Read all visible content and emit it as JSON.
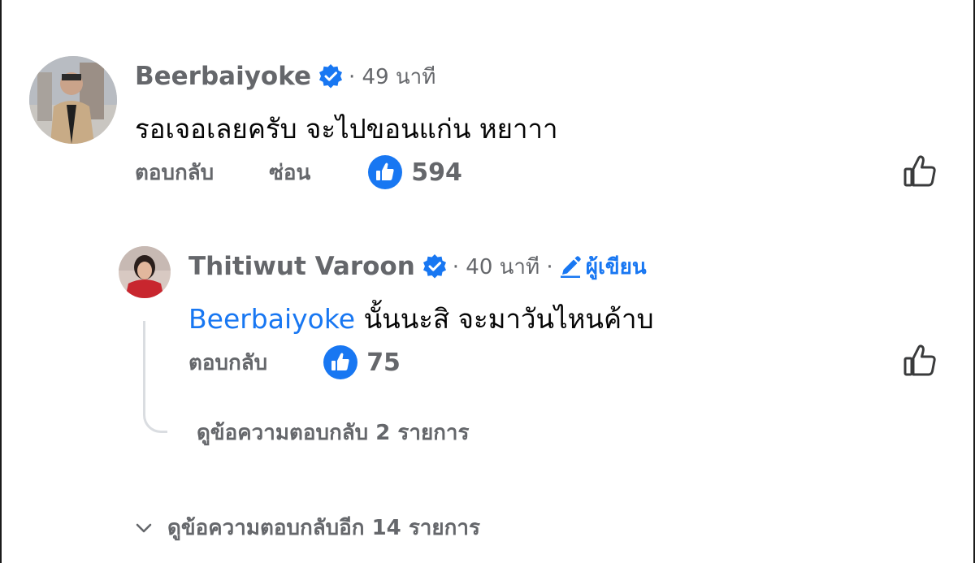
{
  "comment": {
    "author": "Beerbaiyoke",
    "time": "· 49 นาที",
    "text": "รอเจอเลยครับ จะไปขอนแก่น หยาาา",
    "actions": {
      "reply": "ตอบกลับ",
      "hide": "ซ่อน"
    },
    "like_count": "594"
  },
  "reply": {
    "author": "Thitiwut Varoon",
    "time": "· 40 นาที ·",
    "author_badge": "ผู้เขียน",
    "mention": "Beerbaiyoke",
    "text": " นั้นนะสิ จะมาวันไหนค้าบ",
    "actions": {
      "reply": "ตอบกลับ"
    },
    "like_count": "75"
  },
  "view_replies": "ดูข้อความตอบกลับ 2 รายการ",
  "view_more_replies": "ดูข้อความตอบกลับอีก 14 รายการ",
  "colors": {
    "accent": "#1877f2",
    "muted": "#65676b",
    "text": "#050505"
  },
  "icons": {
    "verified": "verified-badge-icon",
    "like_reaction": "like-reaction-icon",
    "like_button": "thumbs-up-outline-icon",
    "author_badge": "pencil-icon",
    "expand": "chevron-down-icon"
  }
}
